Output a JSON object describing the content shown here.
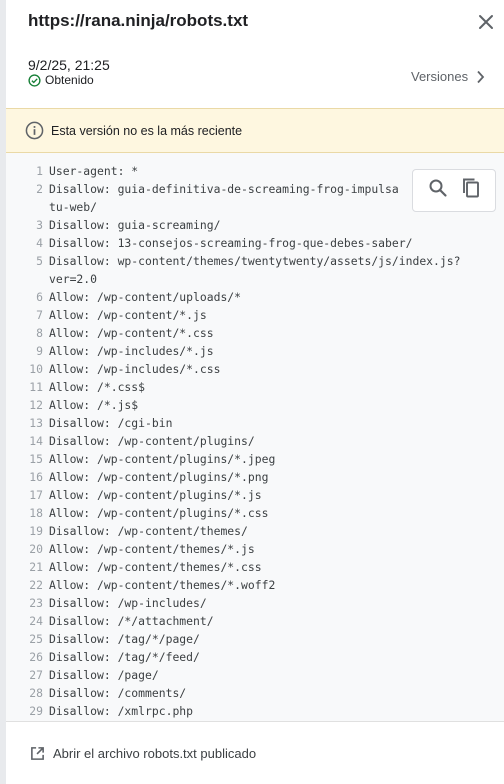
{
  "header": {
    "url": "https://rana.ninja/robots.txt",
    "date": "9/2/25, 21:25",
    "status": "Obtenido",
    "versions_label": "Versiones"
  },
  "warning": {
    "text": "Esta versión no es la más reciente"
  },
  "code": {
    "lines": [
      {
        "n": "1",
        "t": "User-agent: *"
      },
      {
        "n": "2",
        "t": "Disallow: guia-definitiva-de-screaming-frog-impulsa"
      },
      {
        "n": "",
        "t": "tu-web/"
      },
      {
        "n": "3",
        "t": "Disallow: guia-screaming/"
      },
      {
        "n": "4",
        "t": "Disallow: 13-consejos-screaming-frog-que-debes-saber/"
      },
      {
        "n": "5",
        "t": "Disallow: wp-content/themes/twentytwenty/assets/js/index.js?"
      },
      {
        "n": "",
        "t": "ver=2.0"
      },
      {
        "n": "6",
        "t": "Allow: /wp-content/uploads/*"
      },
      {
        "n": "7",
        "t": "Allow: /wp-content/*.js"
      },
      {
        "n": "8",
        "t": "Allow: /wp-content/*.css"
      },
      {
        "n": "9",
        "t": "Allow: /wp-includes/*.js"
      },
      {
        "n": "10",
        "t": "Allow: /wp-includes/*.css"
      },
      {
        "n": "11",
        "t": "Allow: /*.css$"
      },
      {
        "n": "12",
        "t": "Allow: /*.js$"
      },
      {
        "n": "13",
        "t": "Disallow: /cgi-bin"
      },
      {
        "n": "14",
        "t": "Disallow: /wp-content/plugins/"
      },
      {
        "n": "15",
        "t": "Allow: /wp-content/plugins/*.jpeg"
      },
      {
        "n": "16",
        "t": "Allow: /wp-content/plugins/*.png"
      },
      {
        "n": "17",
        "t": "Allow: /wp-content/plugins/*.js"
      },
      {
        "n": "18",
        "t": "Allow: /wp-content/plugins/*.css"
      },
      {
        "n": "19",
        "t": "Disallow: /wp-content/themes/"
      },
      {
        "n": "20",
        "t": "Allow: /wp-content/themes/*.js"
      },
      {
        "n": "21",
        "t": "Allow: /wp-content/themes/*.css"
      },
      {
        "n": "22",
        "t": "Allow: /wp-content/themes/*.woff2"
      },
      {
        "n": "23",
        "t": "Disallow: /wp-includes/"
      },
      {
        "n": "24",
        "t": "Disallow: /*/attachment/"
      },
      {
        "n": "25",
        "t": "Disallow: /tag/*/page/"
      },
      {
        "n": "26",
        "t": "Disallow: /tag/*/feed/"
      },
      {
        "n": "27",
        "t": "Disallow: /page/"
      },
      {
        "n": "28",
        "t": "Disallow: /comments/"
      },
      {
        "n": "29",
        "t": "Disallow: /xmlrpc.php"
      }
    ]
  },
  "footer": {
    "open_label": "Abrir el archivo robots.txt publicado"
  },
  "colors": {
    "accent_green": "#188038",
    "warning_bg": "#fef7e0",
    "code_bg": "#f8f9fa"
  },
  "icons": [
    "close-icon",
    "check-circle-icon",
    "chevron-right-icon",
    "info-icon",
    "search-icon",
    "copy-icon",
    "open-in-new-icon"
  ]
}
